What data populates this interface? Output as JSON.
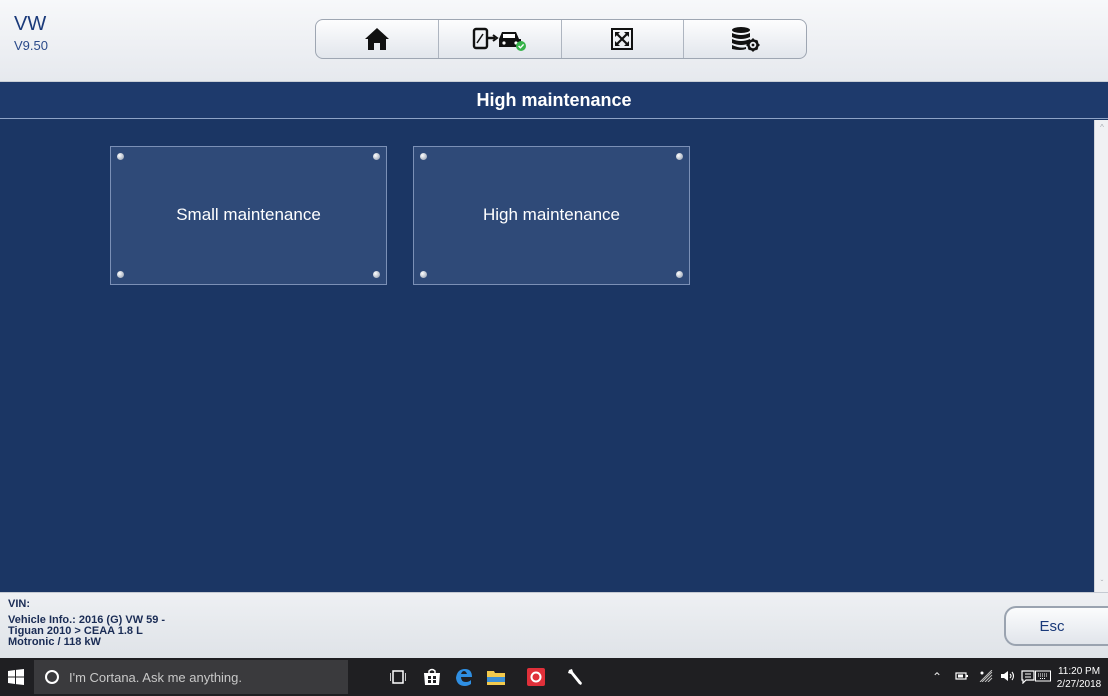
{
  "header": {
    "make": "VW",
    "version": "V9.50",
    "toolbar": [
      {
        "icon": "home-icon"
      },
      {
        "icon": "vehicle-connect-icon"
      },
      {
        "icon": "fullscreen-icon"
      },
      {
        "icon": "database-settings-icon"
      }
    ]
  },
  "title": "High maintenance",
  "tiles": [
    {
      "label": "Small maintenance"
    },
    {
      "label": "High maintenance"
    }
  ],
  "info": {
    "vin_label": "VIN:",
    "vehicle_line1": "Vehicle Info.: 2016 (G) VW 59 -",
    "vehicle_line2": "Tiguan 2010 > CEAA 1.8 L",
    "vehicle_line3": "Motronic / 118 kW",
    "esc_label": "Esc"
  },
  "taskbar": {
    "search_placeholder": "I'm Cortana. Ask me anything.",
    "time": "11:20 PM",
    "date": "2/27/2018"
  },
  "colors": {
    "content_bg": "#1b3664",
    "tile_bg": "#2f4a78",
    "brand_text": "#1a3a7a"
  }
}
